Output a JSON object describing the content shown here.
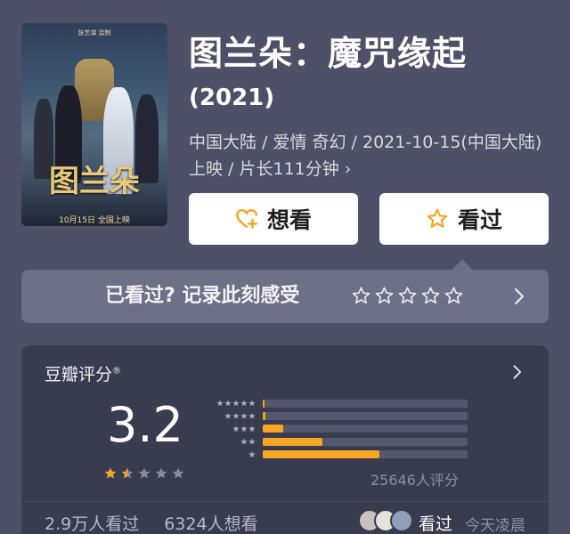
{
  "movie": {
    "title": "图兰朵：魔咒缘起",
    "year": "(2021)",
    "meta": "中国大陆 / 爱情 奇幻 / 2021-10-15(中国大陆)上映 / 片长111分钟 ›"
  },
  "poster": {
    "title": "图兰朵",
    "release": "10月15日 全国上映",
    "top_text": "张艺谋 监制"
  },
  "actions": {
    "want_label": "想看",
    "want_icon": "heart-plus-icon",
    "seen_label": "看过",
    "seen_icon": "star-outline-icon",
    "accent": "#f5a623"
  },
  "record": {
    "prompt": "已看过? 记录此刻感受",
    "stars": 5
  },
  "rating": {
    "label": "豆瓣评分",
    "label_mark": "®",
    "score": "3.2",
    "stars_filled": 1.5,
    "stars_total": 5,
    "distribution": [
      {
        "stars": 5,
        "fraction": 0.01
      },
      {
        "stars": 4,
        "fraction": 0.015
      },
      {
        "stars": 3,
        "fraction": 0.1
      },
      {
        "stars": 2,
        "fraction": 0.29
      },
      {
        "stars": 1,
        "fraction": 0.57
      }
    ],
    "votes": "25646人评分",
    "bar_color": "#f5a623",
    "seen_count": "2.9万人看过",
    "want_count": "6324人想看",
    "friend_action": "看过",
    "friend_time": "今天凌晨"
  }
}
